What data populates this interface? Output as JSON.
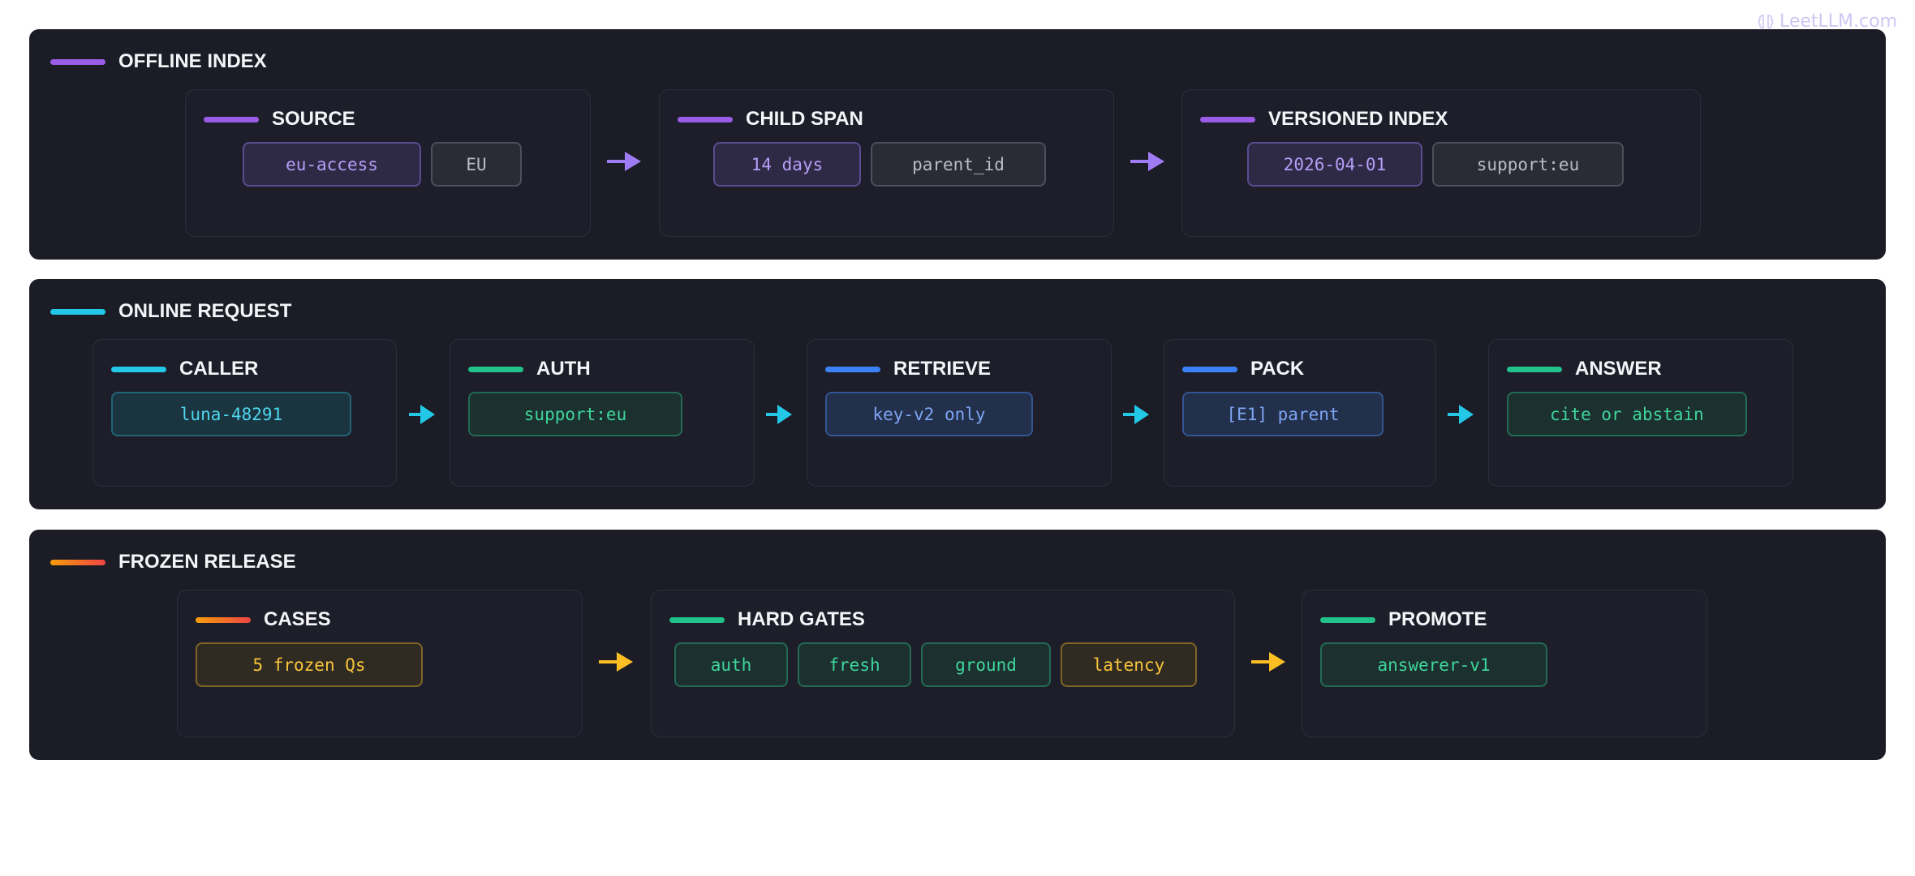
{
  "watermark": "LeetLLM.com",
  "colors": {
    "purple": "#a07cf4",
    "cyan": "#22c8e6",
    "green": "#22c08a",
    "blue": "#3b82f6",
    "amber": "#fbbf24",
    "orange_red": "#ef4444"
  },
  "offline": {
    "title": "OFFLINE INDEX",
    "source": {
      "title": "SOURCE",
      "chips": [
        "eu-access",
        "EU"
      ]
    },
    "child_span": {
      "title": "CHILD SPAN",
      "chips": [
        "14 days",
        "parent_id"
      ]
    },
    "versioned_index": {
      "title": "VERSIONED INDEX",
      "chips": [
        "2026-04-01",
        "support:eu"
      ]
    }
  },
  "online": {
    "title": "ONLINE REQUEST",
    "caller": {
      "title": "CALLER",
      "chip": "luna-48291"
    },
    "auth": {
      "title": "AUTH",
      "chip": "support:eu"
    },
    "retrieve": {
      "title": "RETRIEVE",
      "chip": "key-v2 only"
    },
    "pack": {
      "title": "PACK",
      "chip": "[E1] parent"
    },
    "answer": {
      "title": "ANSWER",
      "chip": "cite or abstain"
    }
  },
  "frozen": {
    "title": "FROZEN RELEASE",
    "cases": {
      "title": "CASES",
      "chip": "5 frozen Qs"
    },
    "hard_gates": {
      "title": "HARD GATES",
      "chips": [
        "auth",
        "fresh",
        "ground",
        "latency"
      ]
    },
    "promote": {
      "title": "PROMOTE",
      "chip": "answerer-v1"
    }
  }
}
